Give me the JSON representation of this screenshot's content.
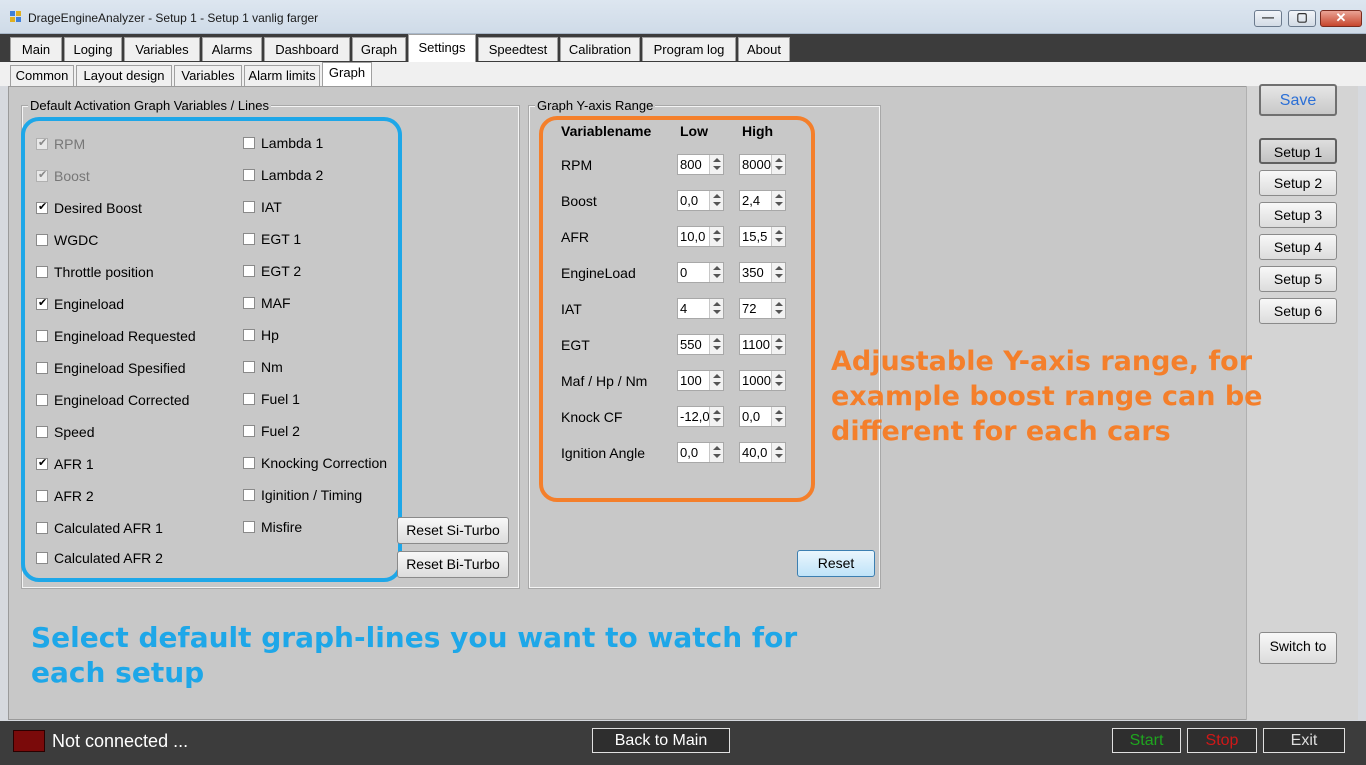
{
  "window": {
    "title": "DrageEngineAnalyzer - Setup 1 - Setup 1 vanlig farger",
    "minimize_glyph": "—",
    "maximize_glyph": "▢",
    "close_glyph": "✕"
  },
  "tabs": [
    "Main",
    "Loging",
    "Variables",
    "Alarms",
    "Dashboard",
    "Graph",
    "Settings",
    "Speedtest",
    "Calibration",
    "Program log",
    "About"
  ],
  "active_tab": "Settings",
  "subtabs": [
    "Common",
    "Layout design",
    "Variables",
    "Alarm limits",
    "Graph"
  ],
  "active_subtab": "Graph",
  "graph_variables": {
    "title": "Default Activation Graph Variables / Lines",
    "left_column": [
      {
        "label": "RPM",
        "checked": true,
        "enabled": false
      },
      {
        "label": "Boost",
        "checked": true,
        "enabled": false
      },
      {
        "label": "Desired Boost",
        "checked": true,
        "enabled": true
      },
      {
        "label": "WGDC",
        "checked": false,
        "enabled": true
      },
      {
        "label": "Throttle position",
        "checked": false,
        "enabled": true
      },
      {
        "label": "Engineload",
        "checked": true,
        "enabled": true
      },
      {
        "label": "Engineload Requested",
        "checked": false,
        "enabled": true
      },
      {
        "label": "Engineload Spesified",
        "checked": false,
        "enabled": true
      },
      {
        "label": "Engineload Corrected",
        "checked": false,
        "enabled": true
      },
      {
        "label": "Speed",
        "checked": false,
        "enabled": true
      },
      {
        "label": "AFR 1",
        "checked": true,
        "enabled": true
      },
      {
        "label": "AFR 2",
        "checked": false,
        "enabled": true
      },
      {
        "label": "Calculated  AFR 1",
        "checked": false,
        "enabled": true
      },
      {
        "label": "Calculated  AFR 2",
        "checked": false,
        "enabled": true
      }
    ],
    "right_column": [
      {
        "label": "Lambda 1",
        "checked": false
      },
      {
        "label": "Lambda 2",
        "checked": false
      },
      {
        "label": "IAT",
        "checked": false
      },
      {
        "label": "EGT 1",
        "checked": false
      },
      {
        "label": "EGT 2",
        "checked": false
      },
      {
        "label": "MAF",
        "checked": false
      },
      {
        "label": "Hp",
        "checked": false
      },
      {
        "label": "Nm",
        "checked": false
      },
      {
        "label": "Fuel 1",
        "checked": false
      },
      {
        "label": "Fuel 2",
        "checked": false
      },
      {
        "label": "Knocking Correction",
        "checked": false
      },
      {
        "label": "Iginition / Timing",
        "checked": false
      },
      {
        "label": "Misfire",
        "checked": false
      }
    ],
    "reset_si_turbo": "Reset Si-Turbo",
    "reset_bi_turbo": "Reset Bi-Turbo",
    "check_glyph": "✔",
    "highlight_color": "#1ea7e8"
  },
  "yaxis": {
    "title": "Graph Y-axis Range",
    "col_name": "Variablename",
    "col_low": "Low",
    "col_high": "High",
    "rows": [
      {
        "name": "RPM",
        "low": "800",
        "high": "8000"
      },
      {
        "name": "Boost",
        "low": "0,0",
        "high": "2,4"
      },
      {
        "name": "AFR",
        "low": "10,0",
        "high": "15,5"
      },
      {
        "name": "EngineLoad",
        "low": "0",
        "high": "350"
      },
      {
        "name": "IAT",
        "low": "4",
        "high": "72"
      },
      {
        "name": "EGT",
        "low": "550",
        "high": "1100"
      },
      {
        "name": "Maf / Hp / Nm",
        "low": "100",
        "high": "1000"
      },
      {
        "name": "Knock CF",
        "low": "-12,0",
        "high": "0,0"
      },
      {
        "name": "Ignition Angle",
        "low": "0,0",
        "high": "40,0"
      }
    ],
    "reset": "Reset",
    "highlight_color": "#f47f2b"
  },
  "annotations": {
    "yaxis": [
      "Adjustable Y-axis range, for",
      "example boost range can be",
      "different for each cars"
    ],
    "graph_lines": [
      "Select default graph-lines you want to watch for",
      "each setup"
    ],
    "orange": "#f47f2b",
    "blue": "#1ea7e8"
  },
  "right_panel": {
    "save": "Save",
    "setups": [
      "Setup 1",
      "Setup 2",
      "Setup 3",
      "Setup 4",
      "Setup 5",
      "Setup 6"
    ],
    "active_setup": "Setup 1",
    "switch_to": "Switch to",
    "save_color": "#2b6fd6"
  },
  "statusbar": {
    "status": "Not connected ...",
    "back_to_main": "Back to Main",
    "start": "Start",
    "stop": "Stop",
    "exit": "Exit",
    "start_color": "#1fa51f",
    "stop_color": "#d01818",
    "led_color": "#7a0a0a"
  }
}
